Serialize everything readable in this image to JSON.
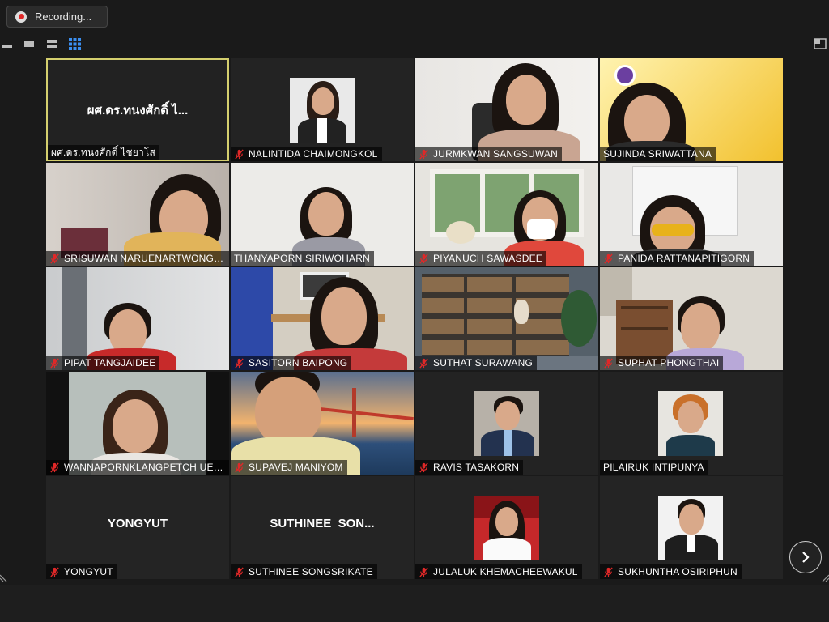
{
  "recording": {
    "label": "Recording..."
  },
  "view_controls": {
    "icons": [
      "minimize-icon",
      "speaker-view-icon",
      "strip-view-icon",
      "gallery-view-icon",
      "fullscreen-icon"
    ]
  },
  "colors": {
    "active_border": "#d4cf6e",
    "mic_muted": "#e02828",
    "tile_bg": "#242424"
  },
  "participants": [
    {
      "name": "ผศ.ดร.ทนงศักดิ์ ไชยาโส",
      "center_label": "ผศ.ดร.ทนงศักดิ์ ไ...",
      "muted": false,
      "active": true,
      "video": "none"
    },
    {
      "name": "NALINTIDA CHAIMONGKOL",
      "muted": true,
      "video": "photo"
    },
    {
      "name": "JURMKWAN SANGSUWAN",
      "muted": true,
      "video": "camera"
    },
    {
      "name": "SUJINDA SRIWATTANA",
      "muted": false,
      "video": "camera"
    },
    {
      "name": "SRISUWAN NARUENARTWONGS...",
      "muted": true,
      "video": "camera"
    },
    {
      "name": "THANYAPORN SIRIWOHARN",
      "muted": false,
      "video": "camera"
    },
    {
      "name": "PIYANUCH SAWASDEE",
      "muted": true,
      "video": "camera"
    },
    {
      "name": "PANIDA RATTANAPITIGORN",
      "muted": true,
      "video": "camera"
    },
    {
      "name": "PIPAT TANGJAIDEE",
      "muted": true,
      "video": "camera"
    },
    {
      "name": "SASITORN BAIPONG",
      "muted": true,
      "video": "camera"
    },
    {
      "name": "SUTHAT SURAWANG",
      "muted": true,
      "video": "camera"
    },
    {
      "name": "SUPHAT PHONGTHAI",
      "muted": true,
      "video": "camera"
    },
    {
      "name": "WANNAPORNKLANGPETCH UEN...",
      "muted": true,
      "video": "camera"
    },
    {
      "name": "SUPAVEJ MANIYOM",
      "muted": true,
      "video": "camera"
    },
    {
      "name": "RAVIS TASAKORN",
      "muted": true,
      "video": "photo"
    },
    {
      "name": "PILAIRUK INTIPUNYA",
      "muted": false,
      "video": "photo"
    },
    {
      "name": "YONGYUT",
      "center_label": "YONGYUT",
      "muted": true,
      "video": "none"
    },
    {
      "name": "SUTHINEE SONGSRIKATE",
      "center_label": "SUTHINEE  SON...",
      "muted": true,
      "video": "none"
    },
    {
      "name": "JULALUK KHEMACHEEWAKUL",
      "muted": true,
      "video": "photo"
    },
    {
      "name": "SUKHUNTHA OSIRIPHUN",
      "muted": true,
      "video": "photo"
    }
  ],
  "navigation": {
    "next_icon": "chevron-right-icon"
  }
}
